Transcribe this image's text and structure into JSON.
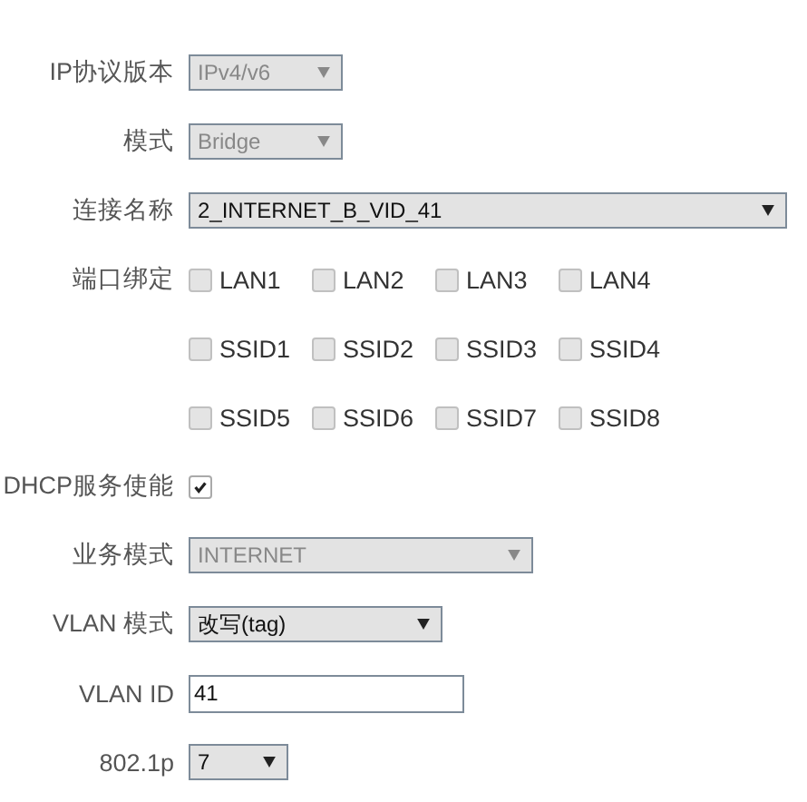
{
  "fields": [
    {
      "kind": "select",
      "label": "IP协议版本",
      "value": "IPv4/v6",
      "disabled": true
    },
    {
      "kind": "select",
      "label": "模式",
      "value": "Bridge",
      "disabled": true
    },
    {
      "kind": "select",
      "label": "连接名称",
      "value": "2_INTERNET_B_VID_41",
      "disabled": false
    },
    {
      "kind": "checkgroup",
      "label": "端口绑定",
      "disabled": true,
      "rows": [
        [
          {
            "label": "LAN1",
            "checked": false
          },
          {
            "label": "LAN2",
            "checked": false
          },
          {
            "label": "LAN3",
            "checked": false
          },
          {
            "label": "LAN4",
            "checked": false
          }
        ],
        [
          {
            "label": "SSID1",
            "checked": false
          },
          {
            "label": "SSID2",
            "checked": false
          },
          {
            "label": "SSID3",
            "checked": false
          },
          {
            "label": "SSID4",
            "checked": false
          }
        ],
        [
          {
            "label": "SSID5",
            "checked": false
          },
          {
            "label": "SSID6",
            "checked": false
          },
          {
            "label": "SSID7",
            "checked": false
          },
          {
            "label": "SSID8",
            "checked": false
          }
        ]
      ]
    },
    {
      "kind": "checkbox",
      "label": "DHCP服务使能",
      "checked": true
    },
    {
      "kind": "select",
      "label": "业务模式",
      "value": "INTERNET",
      "disabled": true
    },
    {
      "kind": "select",
      "label": "VLAN 模式",
      "value": "改写(tag)",
      "disabled": false
    },
    {
      "kind": "input",
      "label": "VLAN ID",
      "value": "41"
    },
    {
      "kind": "select",
      "label": "802.1p",
      "value": "7",
      "disabled": false
    }
  ]
}
